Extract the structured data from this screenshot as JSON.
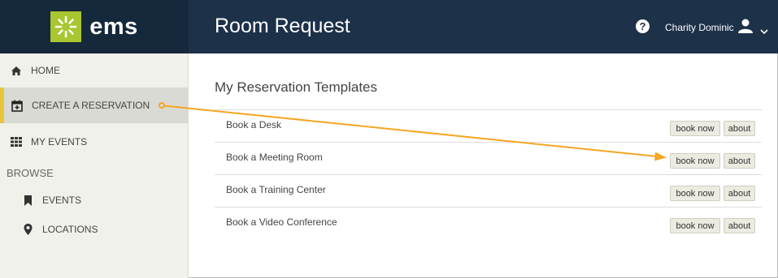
{
  "header": {
    "logo_text": "ems",
    "app_title": "Room Request",
    "help_glyph": "?",
    "user_name": "Charity Dominic",
    "icons": [
      "help-icon",
      "user-icon",
      "chevron-down-icon"
    ],
    "colors": {
      "header_bg": "#1d3149",
      "logo_bg": "#16283c",
      "logo_mark": "#a8c62f"
    }
  },
  "sidebar": {
    "items": [
      {
        "label": "HOME",
        "icon": "home-icon"
      },
      {
        "label": "CREATE A RESERVATION",
        "icon": "calendar-plus-icon"
      },
      {
        "label": "MY EVENTS",
        "icon": "grid-icon"
      }
    ],
    "browse_label": "BROWSE",
    "browse_items": [
      {
        "label": "EVENTS",
        "icon": "bookmark-icon"
      },
      {
        "label": "LOCATIONS",
        "icon": "map-marker-icon"
      }
    ],
    "colors": {
      "active_accent": "#e8c53a",
      "active_bg": "#dadad4"
    }
  },
  "main": {
    "title": "My Reservation Templates",
    "templates": [
      {
        "label": "Book a Desk",
        "book": "book now",
        "about": "about"
      },
      {
        "label": "Book a Meeting Room",
        "book": "book now",
        "about": "about"
      },
      {
        "label": "Book a Training Center",
        "book": "book now",
        "about": "about"
      },
      {
        "label": "Book a Video Conference",
        "book": "book now",
        "about": "about"
      }
    ]
  },
  "annotation": {
    "color": "#f5a623"
  }
}
